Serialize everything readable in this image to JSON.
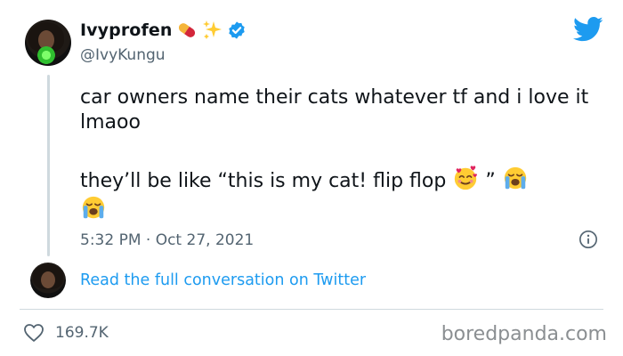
{
  "user": {
    "display_name": "Ivyprofen",
    "handle": "@IvyKungu",
    "badges": [
      "pill-emoji",
      "sparkles-emoji",
      "verified-badge-icon"
    ]
  },
  "tweet": {
    "text_line_1": "car owners name their cats whatever tf and i love it lmaoo",
    "text_line_2_prefix": "they’ll be like “this is my cat! flip flop",
    "text_line_2_quote_close": "”",
    "emojis": [
      "smiling-face-with-hearts",
      "loudly-crying-face",
      "loudly-crying-face"
    ],
    "timestamp": "5:32 PM · Oct 27, 2021"
  },
  "conversation_link": "Read the full conversation on Twitter",
  "likes": "169.7K",
  "watermark": "boredpanda.com",
  "colors": {
    "twitter_blue": "#1d9bf0",
    "secondary_text": "#536471",
    "divider": "#cfd9de"
  }
}
